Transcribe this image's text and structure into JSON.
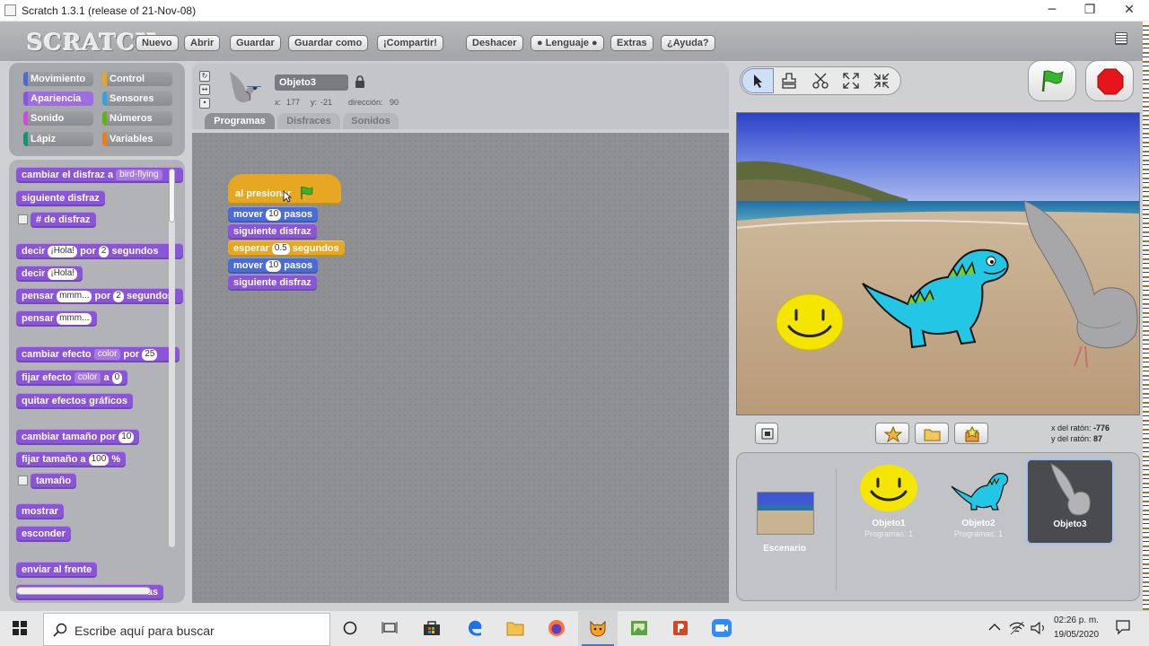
{
  "window": {
    "title": "Scratch 1.3.1 (release of 21-Nov-08)",
    "minimize": "─",
    "maximize": "❐",
    "close": "✕"
  },
  "menubar": {
    "logo": "SCRATCH",
    "buttons": [
      "Nuevo",
      "Abrir",
      "Guardar",
      "Guardar como",
      "¡Compartir!",
      "Deshacer",
      "● Lenguaje ●",
      "Extras",
      "¿Ayuda?"
    ]
  },
  "categories": [
    {
      "label": "Movimiento",
      "color": "#4a6cd4"
    },
    {
      "label": "Control",
      "color": "#e6a822"
    },
    {
      "label": "Apariencia",
      "color": "#8a55d7"
    },
    {
      "label": "Sensores",
      "color": "#2ca5e2"
    },
    {
      "label": "Sonido",
      "color": "#cf4ad9"
    },
    {
      "label": "Números",
      "color": "#5cb712"
    },
    {
      "label": "Lápiz",
      "color": "#0e9a6c"
    },
    {
      "label": "Variables",
      "color": "#ee7d16"
    }
  ],
  "palette": {
    "switch_costume": "cambiar el disfraz a",
    "switch_costume_value": "bird-flying",
    "next_costume": "siguiente disfraz",
    "costume_num": "# de disfraz",
    "say_for": "decir",
    "say_for_value": "¡Hola!",
    "say_for_by": "por",
    "say_for_secs": "2",
    "say_for_unit": "segundos",
    "say": "decir",
    "say_value": "¡Hola!",
    "think_for": "pensar",
    "think_for_value": "mmm...",
    "think_for_by": "por",
    "think_for_secs": "2",
    "think_for_unit": "segundos",
    "think": "pensar",
    "think_value": "mmm...",
    "change_effect": "cambiar efecto",
    "change_effect_dd": "color",
    "change_effect_by": "por",
    "change_effect_value": "25",
    "set_effect": "fijar efecto",
    "set_effect_dd": "color",
    "set_effect_to": "a",
    "set_effect_value": "0",
    "clear_effects": "quitar efectos gráficos",
    "change_size": "cambiar tamaño por",
    "change_size_value": "10",
    "set_size": "fijar tamaño a",
    "set_size_value": "100",
    "set_size_unit": "%",
    "size": "tamaño",
    "show": "mostrar",
    "hide": "esconder",
    "go_front": "enviar al frente",
    "go_back_partial": "as"
  },
  "sprite": {
    "name": "Objeto3",
    "x_label": "x:",
    "x": "177",
    "y_label": "y:",
    "y": "-21",
    "dir_label": "dirección:",
    "direction": "90",
    "tabs": [
      "Programas",
      "Disfraces",
      "Sonidos"
    ]
  },
  "script": {
    "hat": "al presionar",
    "move1": "mover",
    "move1_value": "10",
    "move1_unit": "pasos",
    "next1": "siguiente disfraz",
    "wait": "esperar",
    "wait_value": "0.5",
    "wait_unit": "segundos",
    "move2": "mover",
    "move2_value": "10",
    "move2_unit": "pasos",
    "next2": "siguiente disfraz"
  },
  "stage": {
    "mouse_x_label": "x del ratón:",
    "mouse_x": "-776",
    "mouse_y_label": "y del ratón:",
    "mouse_y": "87"
  },
  "corral": {
    "stage_label": "Escenario",
    "sprites": [
      {
        "name": "Objeto1",
        "scripts": "Programas: 1"
      },
      {
        "name": "Objeto2",
        "scripts": "Programas: 1"
      },
      {
        "name": "Objeto3",
        "scripts": ""
      }
    ]
  },
  "taskbar": {
    "search_placeholder": "Escribe aquí para buscar",
    "time": "02:26 p. m.",
    "date": "19/05/2020"
  }
}
